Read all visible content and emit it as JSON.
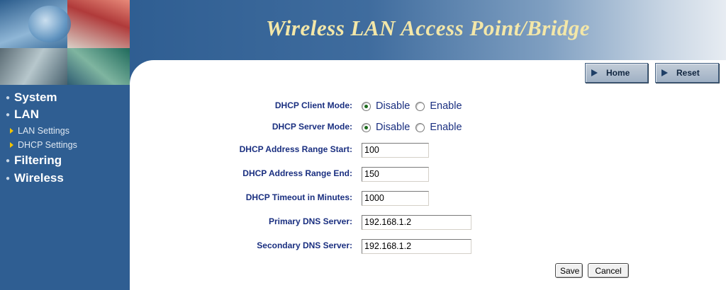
{
  "header": {
    "title": "Wireless LAN Access Point/Bridge",
    "home_label": "Home",
    "reset_label": "Reset"
  },
  "sidebar": {
    "items": [
      {
        "label": "System",
        "type": "main"
      },
      {
        "label": "LAN",
        "type": "main"
      },
      {
        "label": "LAN Settings",
        "type": "sub"
      },
      {
        "label": "DHCP Settings",
        "type": "sub"
      },
      {
        "label": "Filtering",
        "type": "main"
      },
      {
        "label": "Wireless",
        "type": "main"
      }
    ]
  },
  "form": {
    "dhcp_client_mode": {
      "label": "DHCP Client Mode:",
      "options": [
        "Disable",
        "Enable"
      ],
      "selected": "Disable"
    },
    "dhcp_server_mode": {
      "label": "DHCP Server Mode:",
      "options": [
        "Disable",
        "Enable"
      ],
      "selected": "Disable"
    },
    "range_start": {
      "label": "DHCP Address Range Start:",
      "value": "100"
    },
    "range_end": {
      "label": "DHCP Address Range End:",
      "value": "150"
    },
    "timeout": {
      "label": "DHCP Timeout in Minutes:",
      "value": "1000"
    },
    "primary_dns": {
      "label": "Primary DNS Server:",
      "value": "192.168.1.2"
    },
    "secondary_dns": {
      "label": "Secondary DNS Server:",
      "value": "192.168.1.2"
    },
    "save_label": "Save",
    "cancel_label": "Cancel"
  },
  "colors": {
    "sidebar_bg": "#2f5e92",
    "title_text": "#f3e7a8",
    "label_text": "#1a2f80",
    "sub_arrow": "#f3c400"
  },
  "icons": [
    "home-arrow-icon",
    "reset-arrow-icon",
    "bullet-dot-icon",
    "sub-arrow-icon",
    "radio-icon"
  ]
}
